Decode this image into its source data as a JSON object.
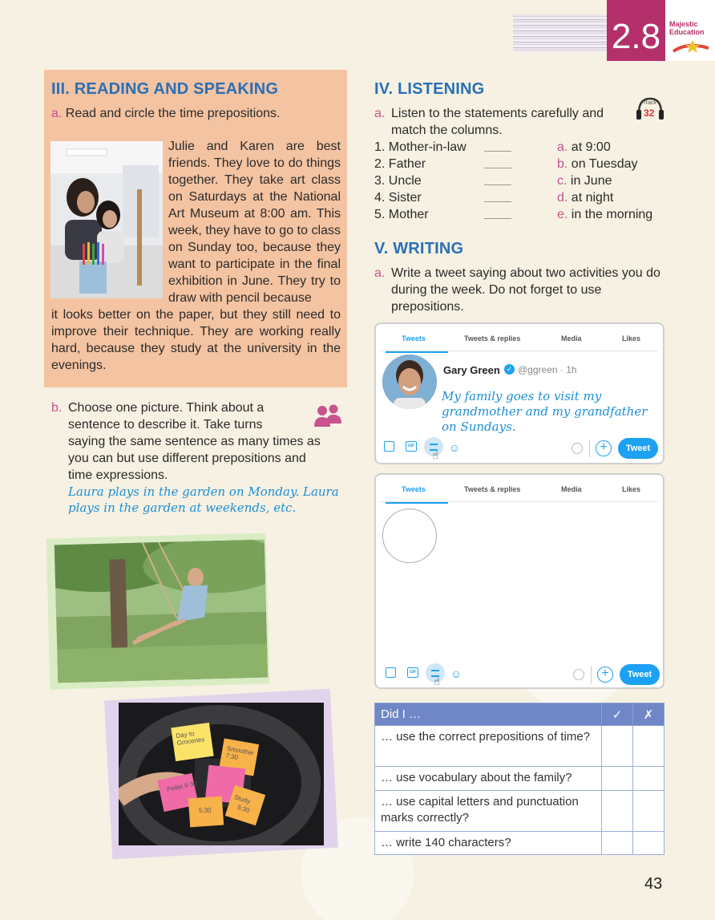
{
  "header": {
    "unit_number": "2.8",
    "logo_text": "Majestic Education"
  },
  "reading": {
    "heading": "III. READING AND SPEAKING",
    "task_a_letter": "a.",
    "task_a_text": "Read and circle the time prepositions.",
    "paragraph_side": "Julie and Karen are best friends. They love to do things together. They take art class on Saturdays at the National Art Museum at 8:00 am. This week, they have to go to class on Sunday too, because they want to participate in the final exhibition in June. They try to draw with pencil because",
    "paragraph_full": "it looks better on the paper, but they still need to improve their technique. They are working really hard, because they study at the university in the evenings."
  },
  "speaking": {
    "task_b_letter": "b.",
    "task_b_line1": "Choose one picture. Think about a",
    "task_b_line2": "sentence to describe it. Take turns",
    "task_b_rest": "saying the same sentence as many times as you can but use different prepositions and time expressions.",
    "example": "Laura plays in the garden on Monday. Laura plays in the garden at weekends, etc."
  },
  "sticky_notes": [
    "Day to Groceries",
    "Pellet 9:30",
    "Smoothie 7:30",
    "5:30",
    "Study",
    "5:30"
  ],
  "listening": {
    "heading": "IV. LISTENING",
    "task_a_letter": "a.",
    "task_a_text": "Listen to the statements carefully and match the columns.",
    "track_label": "Track",
    "track_number": "32",
    "left_column": [
      {
        "num": "1.",
        "text": "Mother-in-law"
      },
      {
        "num": "2.",
        "text": "Father"
      },
      {
        "num": "3.",
        "text": "Uncle"
      },
      {
        "num": "4.",
        "text": "Sister"
      },
      {
        "num": "5.",
        "text": "Mother"
      }
    ],
    "right_column": [
      {
        "letter": "a.",
        "text": "at 9:00"
      },
      {
        "letter": "b.",
        "text": "on Tuesday"
      },
      {
        "letter": "c.",
        "text": "in June"
      },
      {
        "letter": "d.",
        "text": "at night"
      },
      {
        "letter": "e.",
        "text": "in the morning"
      }
    ]
  },
  "writing": {
    "heading": "V. WRITING",
    "task_a_letter": "a.",
    "task_a_text": "Write a tweet saying about two activities you do during the week. Do not forget to use prepositions."
  },
  "tweet_tabs": [
    "Tweets",
    "Tweets & replies",
    "Media",
    "Likes"
  ],
  "tweet_example": {
    "user_name": "Gary Green",
    "handle_time": "@ggreen · 1h",
    "text": "My family goes to visit my grandmother and my grandfather on Sundays.",
    "button_label": "Tweet",
    "gif_label": "GIF"
  },
  "tweet_blank": {
    "button_label": "Tweet",
    "gif_label": "GIF"
  },
  "checklist": {
    "header": "Did I …",
    "check_symbol": "✓",
    "cross_symbol": "✗",
    "rows": [
      "…  use the correct prepositions of time?",
      "… use vocabulary about the family?",
      "… use capital letters and punctuation marks correctly?",
      "… write 140 characters?"
    ]
  },
  "page_number": "43",
  "colors": {
    "heading_blue": "#2a6fb6",
    "letter_pink": "#c9528f",
    "reading_box": "#f4c3a1",
    "twitter_blue": "#1da1f2",
    "table_header": "#6f87c6"
  }
}
